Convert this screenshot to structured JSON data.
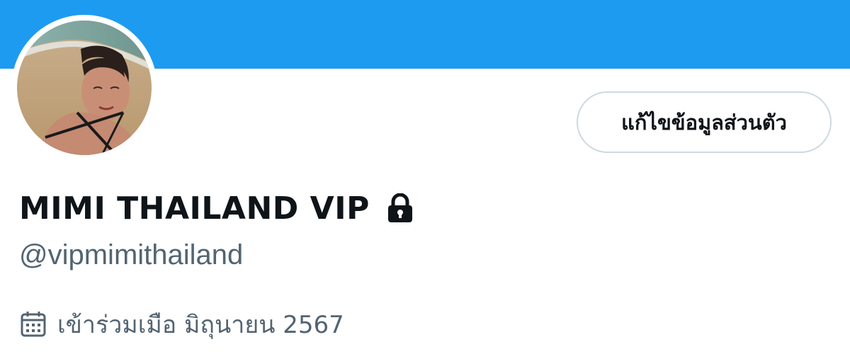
{
  "colors": {
    "banner": "#1d9bf0",
    "text_primary": "#0f1419",
    "text_secondary": "#536471",
    "button_border": "#cfd9de"
  },
  "profile": {
    "avatar_icon": "profile-photo",
    "edit_button_label": "แก้ไขข้อมูลส่วนตัว",
    "display_name": "MIMI THAILAND VIP",
    "protected_icon": "lock-icon",
    "handle": "@vipmimithailand",
    "joined_icon": "calendar-icon",
    "joined_text": "เข้าร่วมเมือ มิถุนายน 2567"
  }
}
